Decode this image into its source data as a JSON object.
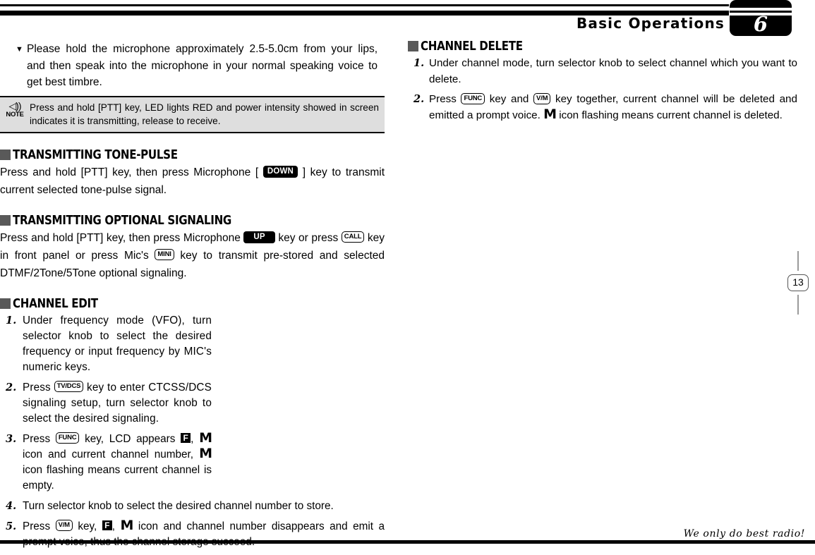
{
  "header": {
    "title": "Basic Operations",
    "chapter_number": "6"
  },
  "tip": {
    "marker": "▼",
    "text": "Please hold the microphone approximately 2.5-5.0cm from your lips, and then speak into the microphone in your normal speaking voice to get best timbre."
  },
  "note": {
    "icon": "speaker-icon",
    "speaker_glyph": "◁))",
    "label": "NOTE",
    "text": "Press and hold [PTT] key, LED lights RED and power intensity showed in screen indicates it is transmitting, release to receive."
  },
  "sections": {
    "tone_pulse": {
      "heading": "TRANSMITTING TONE-PULSE",
      "para_1": "Press and hold [PTT] key, then press Microphone [",
      "key_down": "DOWN",
      "para_2": "] key to transmit current selected tone-pulse signal."
    },
    "optional_signaling": {
      "heading": "TRANSMITTING OPTIONAL SIGNALING",
      "para_1": "Press and hold [PTT] key, then press Microphone",
      "key_up": "UP",
      "para_2": "key or press",
      "key_call": "CALL",
      "para_3": "key in front panel or press Mic's",
      "key_mini": "MINI",
      "para_4": "key to transmit pre-stored and selected DTMF/2Tone/5Tone optional signaling."
    },
    "channel_edit": {
      "heading": "CHANNEL EDIT",
      "steps": [
        {
          "number": "1.",
          "text": "Under frequency mode (VFO), turn selector knob to select the desired frequency or input frequency by MIC's numeric keys."
        },
        {
          "number": "2.",
          "prefix": "Press",
          "key": "TV/DCS",
          "suffix": "key to enter CTCSS/DCS signaling setup, turn selector knob to select the desired signaling."
        },
        {
          "number": "3.",
          "prefix": "Press",
          "key": "FUNC",
          "mid_1": "key, LCD appears",
          "icon_f": "F",
          "mid_2": ",",
          "icon_m_1": "M",
          "mid_3": "icon and current channel number,",
          "icon_m_2": "M",
          "suffix": "icon flashing means current channel is empty."
        },
        {
          "number": "4.",
          "text": "Turn selector knob to select the desired channel number to store."
        },
        {
          "number": "5.",
          "prefix": "Press",
          "key": "V/M",
          "mid_1": "key,",
          "icon_f": "F",
          "mid_2": ",",
          "icon_m": "M",
          "suffix": "icon and channel number disappears and emit a prompt voice, thus the channel storage succeed."
        }
      ]
    },
    "channel_delete": {
      "heading": "CHANNEL DELETE",
      "steps": [
        {
          "number": "1.",
          "text": "Under channel mode, turn selector knob to select channel which you want to delete."
        },
        {
          "number": "2.",
          "prefix": "Press",
          "key_1": "FUNC",
          "mid_1": "key and",
          "key_2": "V/M",
          "mid_2": "key together, current channel will be deleted and emitted a prompt voice.",
          "icon_m": "M",
          "suffix": "icon flashing means current channel is deleted."
        }
      ]
    }
  },
  "page_marker": {
    "number": "13"
  },
  "footer": {
    "tagline": "We only do best radio!"
  }
}
